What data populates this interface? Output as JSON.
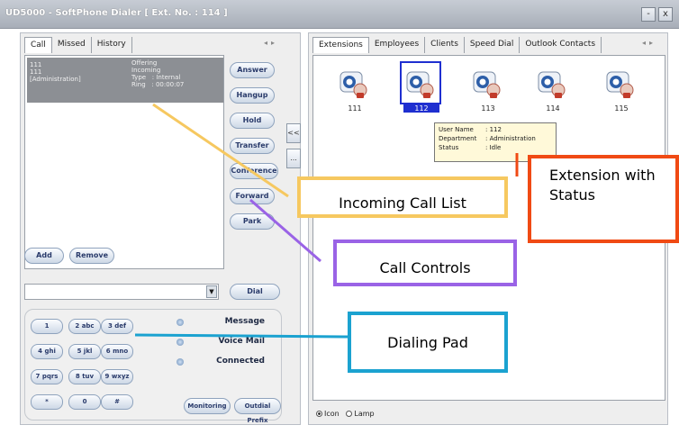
{
  "window": {
    "title": "UD5000 - SoftPhone Dialer [ Ext. No. : 114 ]",
    "minimize": "-",
    "close": "x"
  },
  "left": {
    "tabs": [
      "Call",
      "Missed",
      "History"
    ],
    "call_row": {
      "number": "111",
      "number2": "111",
      "dept": "[Administration]",
      "state": "Offering",
      "direction": "Incoming",
      "type": "Type   : Internal",
      "ring": "Ring   : 00:00:07"
    },
    "controls": [
      "Answer",
      "Hangup",
      "Hold",
      "Transfer",
      "Conference",
      "Forward",
      "Park"
    ],
    "add_label": "Add",
    "remove_label": "Remove",
    "dial_label": "Dial",
    "side_collapse": "<<",
    "side_more": "...",
    "keypad": [
      [
        "1",
        "2 abc",
        "3 def"
      ],
      [
        "4 ghi",
        "5 jkl",
        "6 mno"
      ],
      [
        "7 pqrs",
        "8 tuv",
        "9 wxyz"
      ],
      [
        "*",
        "0",
        "#"
      ]
    ],
    "status": [
      "Message",
      "Voice Mail",
      "Connected"
    ],
    "monitoring": "Monitoring",
    "outdial": "Outdial Prefix"
  },
  "right": {
    "tabs": [
      "Extensions",
      "Employees",
      "Clients",
      "Speed Dial",
      "Outlook Contacts"
    ],
    "extensions": [
      "111",
      "112",
      "113",
      "114",
      "115"
    ],
    "tooltip": {
      "user_name_k": "User Name",
      "user_name_v": ": 112",
      "department_k": "Department",
      "department_v": ": Administration",
      "status_k": "Status",
      "status_v": ": Idle"
    },
    "view_icon": "Icon",
    "view_lamp": "Lamp"
  },
  "callouts": {
    "incoming": "Incoming Call List",
    "controls": "Call Controls",
    "dialing": "Dialing Pad",
    "extension": "Extension with Status"
  },
  "colors": {
    "incoming": "#f6c860",
    "controls": "#9a63e6",
    "dialing": "#1ba2d0",
    "extension": "#f04a14"
  }
}
